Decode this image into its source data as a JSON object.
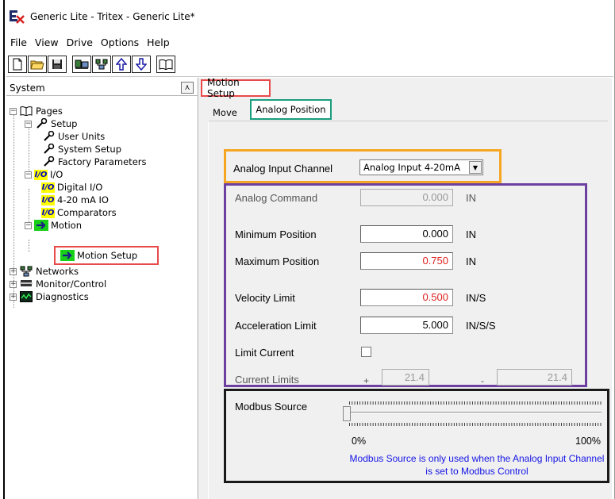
{
  "window": {
    "title": "Generic Lite - Tritex - Generic Lite*"
  },
  "menu": [
    "File",
    "View",
    "Drive",
    "Options",
    "Help"
  ],
  "toolbar": {
    "buttons": [
      "new-icon",
      "open-icon",
      "save-icon",
      "drive-icon",
      "network-icon",
      "upload-icon",
      "download-icon",
      "book-icon"
    ]
  },
  "left_panel": {
    "header": "System",
    "collapse_glyph": "⋏",
    "tree": {
      "pages": "Pages",
      "setup": "Setup",
      "user_units": "User Units",
      "system_setup": "System Setup",
      "factory_parameters": "Factory Parameters",
      "io": "I/O",
      "digital_io": "Digital I/O",
      "ma_io": "4-20 mA IO",
      "comparators": "Comparators",
      "motion": "Motion",
      "motion_setup": "Motion Setup",
      "networks": "Networks",
      "monitor_control": "Monitor/Control",
      "diagnostics": "Diagnostics",
      "io_badge": "I/O"
    }
  },
  "right_panel": {
    "page_tab": "Motion Setup",
    "tabs": {
      "move": "Move",
      "analog_position": "Analog Position"
    },
    "analog_input_channel": {
      "label": "Analog Input Channel",
      "value": "Analog Input 4-20mA"
    },
    "analog_command": {
      "label": "Analog Command",
      "value": "0.000",
      "unit": "IN"
    },
    "minimum_position": {
      "label": "Minimum Position",
      "value": "0.000",
      "unit": "IN"
    },
    "maximum_position": {
      "label": "Maximum Position",
      "value": "0.750",
      "unit": "IN"
    },
    "velocity_limit": {
      "label": "Velocity Limit",
      "value": "0.500",
      "unit": "IN/S"
    },
    "acceleration_limit": {
      "label": "Acceleration Limit",
      "value": "5.000",
      "unit": "IN/S/S"
    },
    "limit_current": {
      "label": "Limit Current",
      "checked": false
    },
    "current_limits": {
      "label": "Current Limits",
      "plus": "+",
      "minus": "-",
      "plus_value": "21.4",
      "minus_value": "21.4"
    },
    "modbus_source": {
      "label": "Modbus Source",
      "min_label": "0%",
      "max_label": "100%",
      "value_percent": 0,
      "note": "Modbus Source is only used when the Analog Input Channel is set to Modbus Control"
    }
  },
  "colors": {
    "highlight_red": "#e84a4a",
    "highlight_teal": "#1a9e7e",
    "highlight_orange": "#f5a623",
    "highlight_purple": "#6d3fa0",
    "highlight_black": "#1a1a1a",
    "value_red": "#e02020",
    "note_blue": "#1414e6"
  }
}
